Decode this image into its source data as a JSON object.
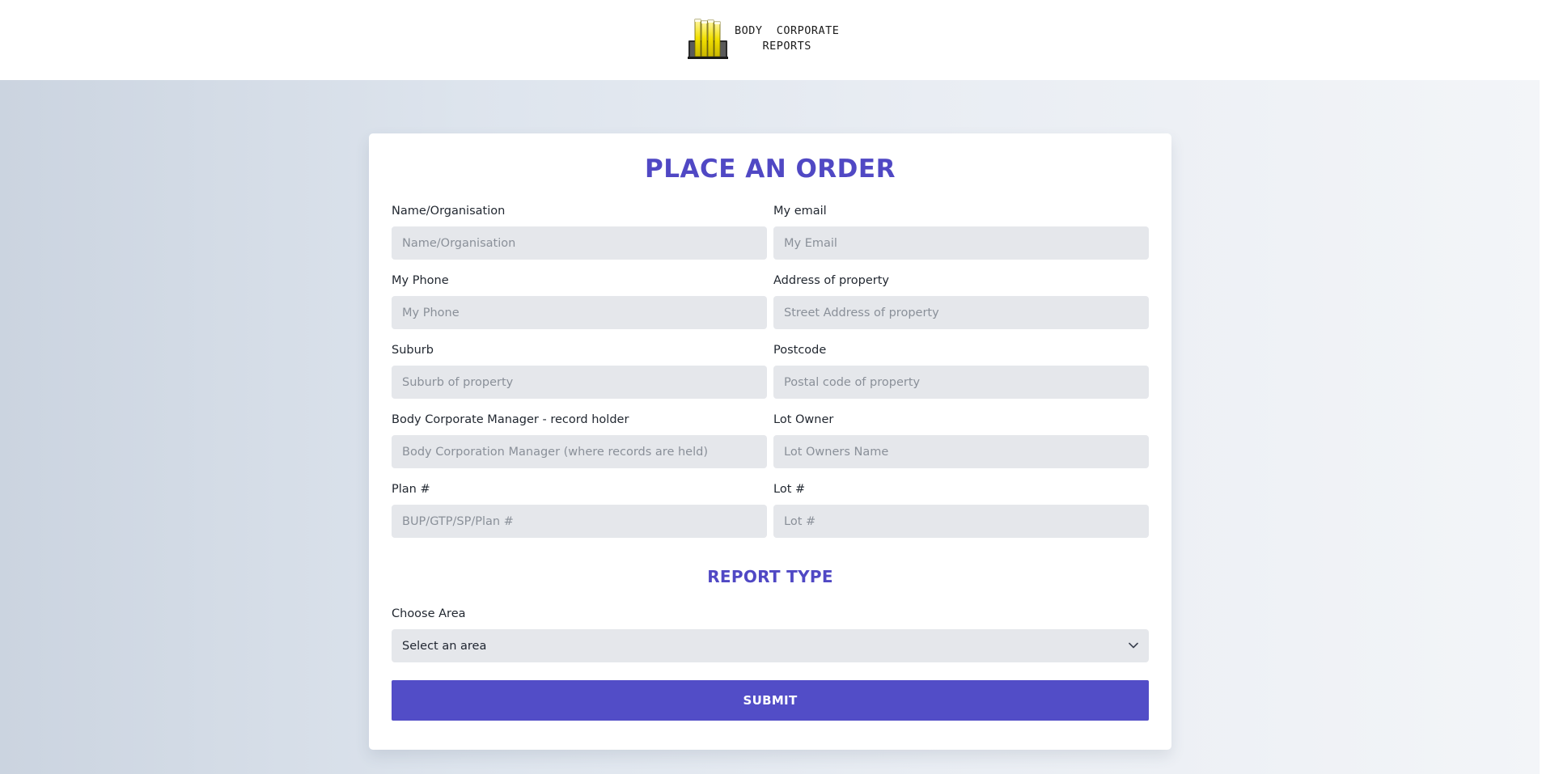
{
  "brand": {
    "line1": "BODY  CORPORATE",
    "line2": "REPORTS",
    "icon": "building-logo-icon"
  },
  "form": {
    "title": "PLACE AN ORDER",
    "fields": {
      "name": {
        "label": "Name/Organisation",
        "placeholder": "Name/Organisation",
        "value": ""
      },
      "email": {
        "label": "My email",
        "placeholder": "My Email",
        "value": ""
      },
      "phone": {
        "label": "My Phone",
        "placeholder": "My Phone",
        "value": ""
      },
      "address": {
        "label": "Address of property",
        "placeholder": "Street Address of property",
        "value": ""
      },
      "suburb": {
        "label": "Suburb",
        "placeholder": "Suburb of property",
        "value": ""
      },
      "postcode": {
        "label": "Postcode",
        "placeholder": "Postal code of property",
        "value": ""
      },
      "manager": {
        "label": "Body Corporate Manager - record holder",
        "placeholder": "Body Corporation Manager (where records are held)",
        "value": ""
      },
      "lot_owner": {
        "label": "Lot Owner",
        "placeholder": "Lot Owners Name",
        "value": ""
      },
      "plan": {
        "label": "Plan #",
        "placeholder": "BUP/GTP/SP/Plan #",
        "value": ""
      },
      "lot": {
        "label": "Lot #",
        "placeholder": "Lot #",
        "value": ""
      }
    },
    "report_type": {
      "title": "REPORT TYPE",
      "area_label": "Choose Area",
      "area_selected": "Select an area"
    },
    "submit_label": "SUBMIT"
  },
  "colors": {
    "accent": "#524dc7",
    "title": "#5048c4",
    "input_bg": "#e5e7eb"
  }
}
